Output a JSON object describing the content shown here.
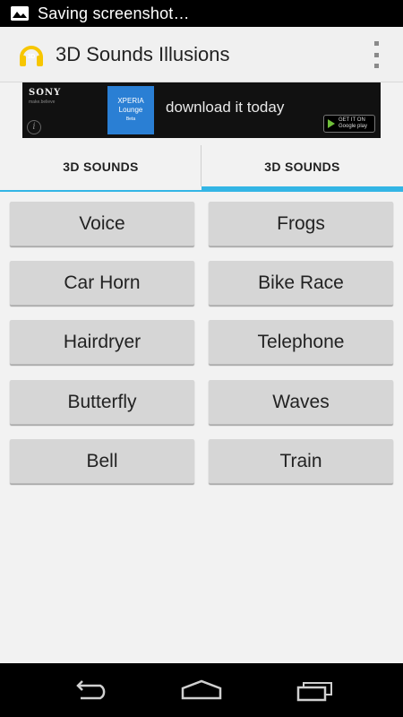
{
  "status_bar": {
    "notification_icon": "gallery-icon",
    "text": "Saving screenshot…"
  },
  "action_bar": {
    "app_icon": "headphones-3d-icon",
    "title": "3D Sounds Illusions",
    "overflow_icon": "overflow-menu-icon"
  },
  "ad": {
    "brand": "SONY",
    "brand_sub": "make.believe",
    "product_line1": "XPERIA",
    "product_line2": "Lounge",
    "product_line3": "Beta",
    "headline": "download it today",
    "store_text_top": "GET IT ON",
    "store_text_bottom": "Google play",
    "info_icon": "i"
  },
  "tabs": [
    {
      "label": "3D SOUNDS",
      "selected": false
    },
    {
      "label": "3D SOUNDS",
      "selected": true
    }
  ],
  "sounds": [
    "Voice",
    "Frogs",
    "Car Horn",
    "Bike Race",
    "Hairdryer",
    "Telephone",
    "Butterfly",
    "Waves",
    "Bell",
    "Train"
  ],
  "nav_bar": {
    "back_icon": "back-icon",
    "home_icon": "home-icon",
    "recents_icon": "recent-apps-icon"
  },
  "colors": {
    "accent": "#33b5e5",
    "button_bg": "#d6d6d6",
    "app_icon": "#f7c600"
  }
}
